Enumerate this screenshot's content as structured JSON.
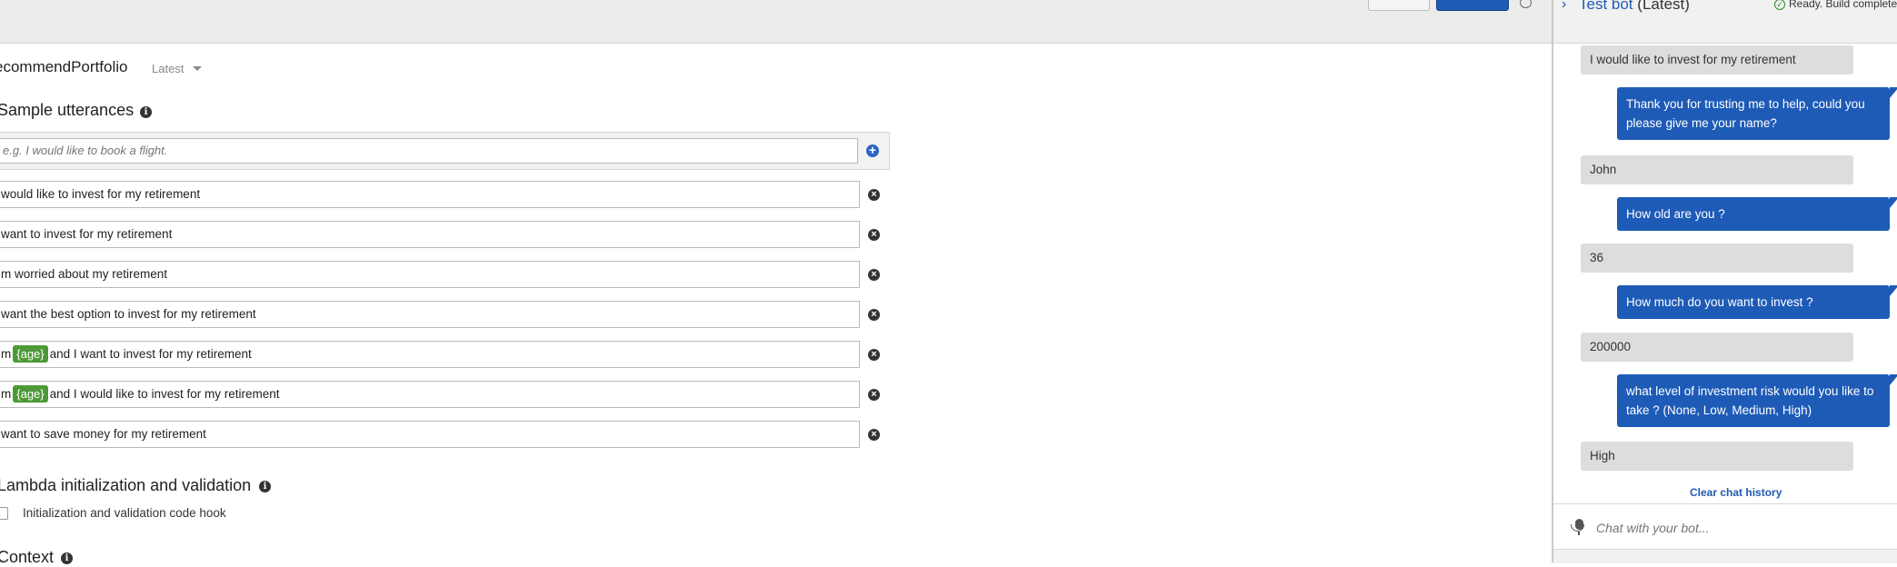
{
  "intent": {
    "name": "ecommendPortfolio",
    "version": "Latest"
  },
  "sample_utterances": {
    "title": "Sample utterances",
    "input_placeholder": "e.g. I would like to book a flight.",
    "rows": [
      {
        "before": "would like to invest for my retirement",
        "slot": "",
        "after": ""
      },
      {
        "before": "want to invest for my retirement",
        "slot": "",
        "after": ""
      },
      {
        "before": "m worried about my retirement",
        "slot": "",
        "after": ""
      },
      {
        "before": "want the best option to invest for my retirement",
        "slot": "",
        "after": ""
      },
      {
        "before": "m",
        "slot": "{age}",
        "after": "and I want to invest for my retirement"
      },
      {
        "before": "m",
        "slot": "{age}",
        "after": "and I would like to invest for my retirement"
      },
      {
        "before": "want to save money for my retirement",
        "slot": "",
        "after": ""
      }
    ]
  },
  "lambda": {
    "title": "Lambda initialization and validation",
    "checkbox_label": "Initialization and validation code hook"
  },
  "context": {
    "title": "Context"
  },
  "test_bot": {
    "title_link": "Test bot",
    "title_version": "(Latest)",
    "status": "Ready. Build complete",
    "messages": [
      {
        "from": "user",
        "text": "I would like to invest for my retirement"
      },
      {
        "from": "bot",
        "text": "Thank you for trusting me to help, could you please give me your name?"
      },
      {
        "from": "user",
        "text": "John"
      },
      {
        "from": "bot",
        "text": "How old are you ?"
      },
      {
        "from": "user",
        "text": "36"
      },
      {
        "from": "bot",
        "text": "How much do you want to invest ?"
      },
      {
        "from": "user",
        "text": "200000"
      },
      {
        "from": "bot",
        "text": "what level of investment risk would you like to take ? (None, Low, Medium, High)"
      },
      {
        "from": "user",
        "text": "High"
      }
    ],
    "clear_history": "Clear chat history",
    "input_placeholder": "Chat with your bot..."
  },
  "icons": {
    "info": "info-icon",
    "add": "plus-circle-icon",
    "remove": "x-circle-icon",
    "microphone": "microphone-icon",
    "status": "check-circle-icon",
    "expand": "chevron-right-icon"
  },
  "colors": {
    "accent": "#1e5bb7",
    "slot": "#4c9a35",
    "bot_bubble": "#1e5bb7",
    "user_bubble": "#dddddd"
  }
}
